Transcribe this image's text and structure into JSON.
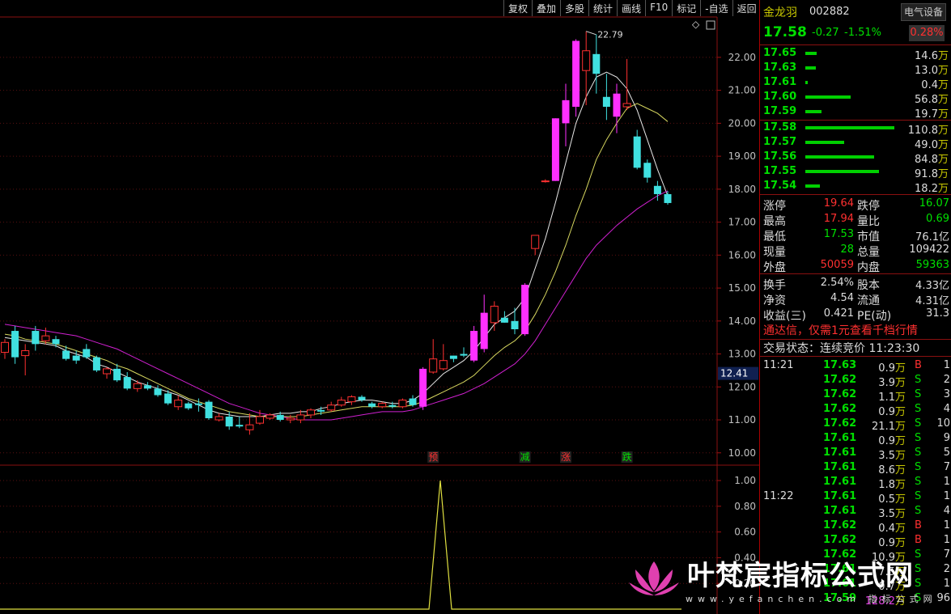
{
  "toolbar": [
    "复权",
    "叠加",
    "多股",
    "统计",
    "画线",
    "F10",
    "标记",
    "-自选",
    "返回"
  ],
  "stock": {
    "name": "金龙羽",
    "code": "002882",
    "sector_button": "电气设备",
    "last": "17.58",
    "change": "-0.27",
    "change_pct": "-1.51%",
    "amplitude": "0.28%"
  },
  "order_book": {
    "asks": [
      {
        "price": "17.65",
        "vol": "14.6",
        "unit": "万",
        "bar": 0.13
      },
      {
        "price": "17.63",
        "vol": "13.0",
        "unit": "万",
        "bar": 0.12
      },
      {
        "price": "17.61",
        "vol": "0.4",
        "unit": "万",
        "bar": 0.01
      },
      {
        "price": "17.60",
        "vol": "56.8",
        "unit": "万",
        "bar": 0.51
      },
      {
        "price": "17.59",
        "vol": "19.7",
        "unit": "万",
        "bar": 0.18
      }
    ],
    "bids": [
      {
        "price": "17.58",
        "vol": "110.8",
        "unit": "万",
        "bar": 1.0
      },
      {
        "price": "17.57",
        "vol": "49.0",
        "unit": "万",
        "bar": 0.44
      },
      {
        "price": "17.56",
        "vol": "84.8",
        "unit": "万",
        "bar": 0.77
      },
      {
        "price": "17.55",
        "vol": "91.8",
        "unit": "万",
        "bar": 0.83
      },
      {
        "price": "17.54",
        "vol": "18.2",
        "unit": "万",
        "bar": 0.16
      }
    ]
  },
  "stats": {
    "limit_up": {
      "label": "涨停",
      "value": "19.64"
    },
    "limit_down": {
      "label": "跌停",
      "value": "16.07"
    },
    "high": {
      "label": "最高",
      "value": "17.94"
    },
    "vol_ratio": {
      "label": "量比",
      "value": "0.69"
    },
    "low": {
      "label": "最低",
      "value": "17.53"
    },
    "mkt_cap": {
      "label": "市值",
      "value": "76.1亿"
    },
    "cur_vol": {
      "label": "现量",
      "value": "28"
    },
    "total_vol": {
      "label": "总量",
      "value": "109422"
    },
    "outer": {
      "label": "外盘",
      "value": "50059"
    },
    "inner": {
      "label": "内盘",
      "value": "59363"
    },
    "turnover": {
      "label": "换手",
      "value": "2.54%"
    },
    "shares": {
      "label": "股本",
      "value": "4.33亿"
    },
    "nav": {
      "label": "净资",
      "value": "4.54"
    },
    "float": {
      "label": "流通",
      "value": "4.31亿"
    },
    "eps": {
      "label": "收益(三)",
      "value": "0.421"
    },
    "pe": {
      "label": "PE(动)",
      "value": "31.3"
    }
  },
  "promo": "通达信，仅需1元查看千档行情",
  "trade_status": "交易状态：连续竞价 11:23:30",
  "ticks": [
    {
      "time": "11:21",
      "price": "17.63",
      "vol": "0.9",
      "side": "B",
      "cnt": "1"
    },
    {
      "time": "",
      "price": "17.62",
      "vol": "3.9",
      "side": "S",
      "cnt": "2"
    },
    {
      "time": "",
      "price": "17.62",
      "vol": "1.1",
      "side": "S",
      "cnt": "3"
    },
    {
      "time": "",
      "price": "17.62",
      "vol": "0.9",
      "side": "S",
      "cnt": "4"
    },
    {
      "time": "",
      "price": "17.62",
      "vol": "21.1",
      "side": "S",
      "cnt": "10"
    },
    {
      "time": "",
      "price": "17.61",
      "vol": "0.9",
      "side": "S",
      "cnt": "9"
    },
    {
      "time": "",
      "price": "17.61",
      "vol": "3.5",
      "side": "S",
      "cnt": "5"
    },
    {
      "time": "",
      "price": "17.61",
      "vol": "8.6",
      "side": "S",
      "cnt": "7"
    },
    {
      "time": "",
      "price": "17.61",
      "vol": "1.8",
      "side": "S",
      "cnt": "1"
    },
    {
      "time": "11:22",
      "price": "17.61",
      "vol": "0.5",
      "side": "S",
      "cnt": "1"
    },
    {
      "time": "",
      "price": "17.61",
      "vol": "3.5",
      "side": "S",
      "cnt": "4"
    },
    {
      "time": "",
      "price": "17.62",
      "vol": "0.4",
      "side": "B",
      "cnt": "1"
    },
    {
      "time": "",
      "price": "17.62",
      "vol": "0.9",
      "side": "B",
      "cnt": "1"
    },
    {
      "time": "",
      "price": "17.62",
      "vol": "10.9",
      "side": "S",
      "cnt": "7"
    },
    {
      "time": "",
      "price": "17.61",
      "vol": "7.5",
      "side": "S",
      "cnt": "2"
    },
    {
      "time": "",
      "price": "17.61",
      "vol": "0.7",
      "side": "S",
      "cnt": "1"
    },
    {
      "time": "",
      "price": "17.59",
      "vol": "128.2",
      "side": "S",
      "cnt": "96",
      "big": true
    }
  ],
  "tick_unit": "万",
  "watermark": {
    "title": "叶梵宸指标公式网",
    "url": "www.yefanchen.com 指标公式网"
  },
  "chart_data": {
    "type": "candlestick",
    "y_ticks": [
      "22.00",
      "21.00",
      "20.00",
      "19.00",
      "18.00",
      "17.00",
      "16.00",
      "15.00",
      "14.00",
      "13.00",
      "12.00",
      "11.00",
      "10.00"
    ],
    "ylim": [
      9.7,
      23.2
    ],
    "current_price_label": "12.41",
    "max_label": "22.79",
    "signals": [
      {
        "index": 21,
        "text": "预",
        "color": "#ff3030"
      },
      {
        "index": 26,
        "text": "减",
        "color": "#00e000"
      },
      {
        "index": 28,
        "text": "涨",
        "color": "#ff3030"
      },
      {
        "index": 31,
        "text": "跌",
        "color": "#00e000"
      }
    ],
    "candles": [
      {
        "o": 13.05,
        "h": 13.45,
        "l": 12.85,
        "c": 13.35
      },
      {
        "o": 13.7,
        "h": 13.85,
        "l": 12.7,
        "c": 12.9
      },
      {
        "o": 12.95,
        "h": 13.3,
        "l": 12.35,
        "c": 13.1
      },
      {
        "o": 13.7,
        "h": 13.85,
        "l": 13.1,
        "c": 13.3
      },
      {
        "o": 13.4,
        "h": 13.8,
        "l": 13.3,
        "c": 13.55
      },
      {
        "o": 13.45,
        "h": 13.55,
        "l": 13.2,
        "c": 13.3
      },
      {
        "o": 13.1,
        "h": 13.25,
        "l": 12.8,
        "c": 12.85
      },
      {
        "o": 12.95,
        "h": 13.1,
        "l": 12.7,
        "c": 12.8
      },
      {
        "o": 13.15,
        "h": 13.3,
        "l": 12.85,
        "c": 12.9
      },
      {
        "o": 12.9,
        "h": 12.95,
        "l": 12.45,
        "c": 12.5
      },
      {
        "o": 12.4,
        "h": 12.6,
        "l": 12.25,
        "c": 12.55
      },
      {
        "o": 12.55,
        "h": 12.7,
        "l": 12.15,
        "c": 12.2
      },
      {
        "o": 12.3,
        "h": 12.45,
        "l": 11.9,
        "c": 11.95
      },
      {
        "o": 11.95,
        "h": 12.2,
        "l": 11.85,
        "c": 12.1
      },
      {
        "o": 12.05,
        "h": 12.15,
        "l": 11.9,
        "c": 11.95
      },
      {
        "o": 11.95,
        "h": 12.05,
        "l": 11.7,
        "c": 11.75
      },
      {
        "o": 11.8,
        "h": 11.9,
        "l": 11.45,
        "c": 11.5
      },
      {
        "o": 11.4,
        "h": 11.75,
        "l": 11.3,
        "c": 11.6
      },
      {
        "o": 11.5,
        "h": 11.55,
        "l": 11.3,
        "c": 11.35
      },
      {
        "o": 11.5,
        "h": 11.65,
        "l": 11.25,
        "c": 11.45
      },
      {
        "o": 11.55,
        "h": 11.6,
        "l": 11.0,
        "c": 11.05
      },
      {
        "o": 11.0,
        "h": 11.2,
        "l": 10.95,
        "c": 11.1
      },
      {
        "o": 11.1,
        "h": 11.25,
        "l": 10.7,
        "c": 10.8
      },
      {
        "o": 10.85,
        "h": 11.1,
        "l": 10.75,
        "c": 10.8
      },
      {
        "o": 10.7,
        "h": 11.2,
        "l": 10.55,
        "c": 10.85
      },
      {
        "o": 10.9,
        "h": 11.3,
        "l": 10.85,
        "c": 11.1
      },
      {
        "o": 11.05,
        "h": 11.2,
        "l": 11.0,
        "c": 11.15
      },
      {
        "o": 11.15,
        "h": 11.25,
        "l": 10.95,
        "c": 11.0
      },
      {
        "o": 11.0,
        "h": 11.15,
        "l": 10.9,
        "c": 11.05
      },
      {
        "o": 11.0,
        "h": 11.3,
        "l": 10.9,
        "c": 11.15
      },
      {
        "o": 11.15,
        "h": 11.35,
        "l": 11.05,
        "c": 11.3
      },
      {
        "o": 11.3,
        "h": 11.4,
        "l": 11.15,
        "c": 11.25
      },
      {
        "o": 11.3,
        "h": 11.55,
        "l": 11.25,
        "c": 11.45
      },
      {
        "o": 11.45,
        "h": 11.7,
        "l": 11.4,
        "c": 11.6
      },
      {
        "o": 11.55,
        "h": 11.75,
        "l": 11.45,
        "c": 11.7
      },
      {
        "o": 11.7,
        "h": 11.75,
        "l": 11.55,
        "c": 11.6
      },
      {
        "o": 11.5,
        "h": 11.55,
        "l": 11.35,
        "c": 11.4
      },
      {
        "o": 11.4,
        "h": 11.55,
        "l": 11.35,
        "c": 11.5
      },
      {
        "o": 11.45,
        "h": 11.55,
        "l": 11.35,
        "c": 11.4
      },
      {
        "o": 11.4,
        "h": 11.65,
        "l": 11.35,
        "c": 11.6
      },
      {
        "o": 11.65,
        "h": 11.75,
        "l": 11.4,
        "c": 11.45
      },
      {
        "o": 11.4,
        "h": 12.6,
        "l": 11.3,
        "c": 12.55
      },
      {
        "o": 12.45,
        "h": 13.45,
        "l": 12.4,
        "c": 12.85
      },
      {
        "o": 12.55,
        "h": 13.3,
        "l": 12.5,
        "c": 12.8
      },
      {
        "o": 12.95,
        "h": 12.95,
        "l": 12.75,
        "c": 12.85
      },
      {
        "o": 13.0,
        "h": 13.2,
        "l": 12.9,
        "c": 12.95
      },
      {
        "o": 12.8,
        "h": 13.85,
        "l": 12.75,
        "c": 13.7
      },
      {
        "o": 13.15,
        "h": 14.8,
        "l": 13.05,
        "c": 14.25
      },
      {
        "o": 13.95,
        "h": 14.6,
        "l": 13.7,
        "c": 14.45
      },
      {
        "o": 14.1,
        "h": 14.3,
        "l": 13.95,
        "c": 13.95
      },
      {
        "o": 14.0,
        "h": 14.4,
        "l": 13.6,
        "c": 13.75
      },
      {
        "o": 13.6,
        "h": 15.15,
        "l": 13.55,
        "c": 15.1
      },
      {
        "o": 16.2,
        "h": 16.6,
        "l": 16.0,
        "c": 16.6
      },
      {
        "o": 18.25,
        "h": 18.3,
        "l": 18.2,
        "c": 18.25
      },
      {
        "o": 18.25,
        "h": 20.15,
        "l": 18.25,
        "c": 20.15
      },
      {
        "o": 20.0,
        "h": 21.2,
        "l": 19.3,
        "c": 20.7
      },
      {
        "o": 20.5,
        "h": 22.55,
        "l": 20.2,
        "c": 22.5
      },
      {
        "o": 21.6,
        "h": 22.79,
        "l": 20.55,
        "c": 22.2
      },
      {
        "o": 22.1,
        "h": 22.7,
        "l": 20.9,
        "c": 21.5
      },
      {
        "o": 20.8,
        "h": 21.5,
        "l": 20.1,
        "c": 20.5
      },
      {
        "o": 20.2,
        "h": 21.2,
        "l": 19.7,
        "c": 20.9
      },
      {
        "o": 20.5,
        "h": 21.95,
        "l": 20.4,
        "c": 20.6
      },
      {
        "o": 19.6,
        "h": 19.8,
        "l": 18.6,
        "c": 18.65
      },
      {
        "o": 18.8,
        "h": 18.9,
        "l": 18.2,
        "c": 18.35
      },
      {
        "o": 18.1,
        "h": 18.25,
        "l": 17.65,
        "c": 17.85
      },
      {
        "o": 17.85,
        "h": 17.94,
        "l": 17.53,
        "c": 17.58
      }
    ],
    "ma_white": [
      13.5,
      13.45,
      13.4,
      13.35,
      13.3,
      13.25,
      13.1,
      13.0,
      12.9,
      12.7,
      12.6,
      12.45,
      12.3,
      12.15,
      12.05,
      11.95,
      11.85,
      11.75,
      11.6,
      11.45,
      11.3,
      11.2,
      11.15,
      11.1,
      11.1,
      11.1,
      11.15,
      11.2,
      11.2,
      11.25,
      11.25,
      11.35,
      11.4,
      11.5,
      11.55,
      11.6,
      11.6,
      11.55,
      11.5,
      11.5,
      11.6,
      11.8,
      12.1,
      12.4,
      12.6,
      12.8,
      13.1,
      13.5,
      13.9,
      14.1,
      14.3,
      14.7,
      15.6,
      16.5,
      17.6,
      18.8,
      20.0,
      20.8,
      21.4,
      21.55,
      21.4,
      21.05,
      20.4,
      19.5,
      18.6,
      17.8
    ],
    "ma_yellow": [
      13.6,
      13.55,
      13.45,
      13.4,
      13.35,
      13.3,
      13.2,
      13.1,
      13.0,
      12.9,
      12.8,
      12.65,
      12.55,
      12.4,
      12.25,
      12.1,
      11.95,
      11.8,
      11.65,
      11.55,
      11.45,
      11.35,
      11.25,
      11.2,
      11.15,
      11.1,
      11.1,
      11.1,
      11.1,
      11.1,
      11.15,
      11.2,
      11.25,
      11.3,
      11.35,
      11.4,
      11.4,
      11.4,
      11.4,
      11.4,
      11.45,
      11.55,
      11.7,
      11.85,
      12.0,
      12.15,
      12.35,
      12.65,
      12.95,
      13.2,
      13.4,
      13.7,
      14.2,
      14.8,
      15.5,
      16.3,
      17.2,
      18.0,
      18.9,
      19.5,
      20.0,
      20.45,
      20.6,
      20.45,
      20.3,
      20.05
    ],
    "ma_magenta": [
      13.9,
      13.85,
      13.8,
      13.75,
      13.7,
      13.65,
      13.6,
      13.55,
      13.45,
      13.35,
      13.25,
      13.15,
      13.0,
      12.85,
      12.7,
      12.55,
      12.4,
      12.25,
      12.1,
      11.95,
      11.8,
      11.65,
      11.5,
      11.4,
      11.3,
      11.2,
      11.15,
      11.1,
      11.05,
      11.0,
      11.0,
      11.0,
      11.0,
      11.05,
      11.1,
      11.15,
      11.2,
      11.25,
      11.25,
      11.25,
      11.3,
      11.4,
      11.5,
      11.6,
      11.7,
      11.8,
      11.95,
      12.1,
      12.3,
      12.5,
      12.7,
      13.0,
      13.4,
      13.9,
      14.4,
      14.9,
      15.4,
      15.9,
      16.3,
      16.6,
      16.9,
      17.15,
      17.4,
      17.6,
      17.8,
      17.95
    ],
    "indicator": {
      "y_ticks": [
        "1.00",
        "0.80",
        "0.60",
        "0.40",
        "0.20"
      ],
      "spike_index": 21,
      "spike_value": 1.0
    }
  }
}
